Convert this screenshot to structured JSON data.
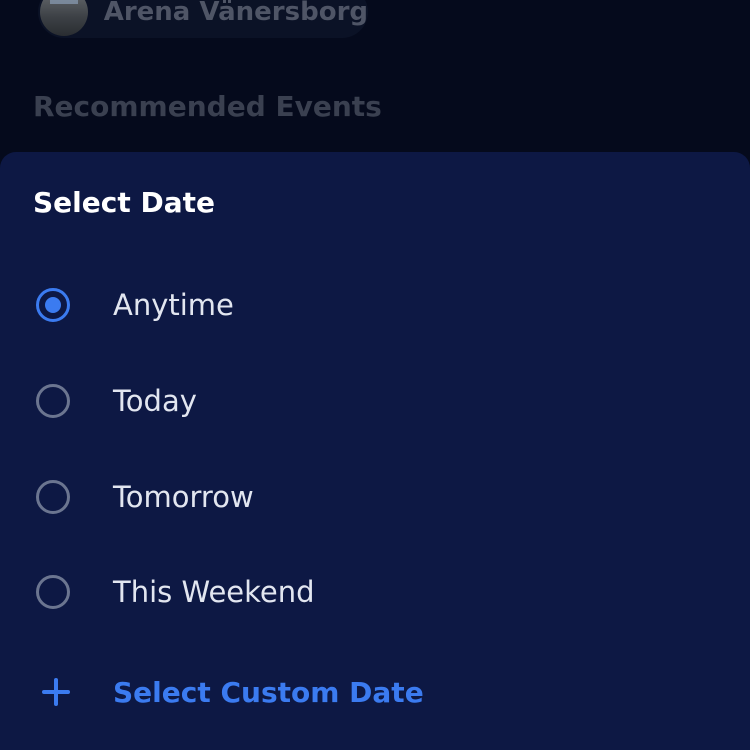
{
  "background": {
    "venue_name": "Arena Vänersborg",
    "section_heading": "Recommended Events"
  },
  "sheet": {
    "title": "Select Date",
    "options": [
      {
        "label": "Anytime",
        "selected": true
      },
      {
        "label": "Today",
        "selected": false
      },
      {
        "label": "Tomorrow",
        "selected": false
      },
      {
        "label": "This Weekend",
        "selected": false
      }
    ],
    "custom_date_label": "Select Custom Date",
    "custom_date_icon": "plus-icon"
  },
  "colors": {
    "sheet_background": "#0d1844",
    "page_background": "#050a1c",
    "accent": "#3b7bf0",
    "radio_unselected": "#6b7590",
    "option_text": "#e2e6f0"
  }
}
